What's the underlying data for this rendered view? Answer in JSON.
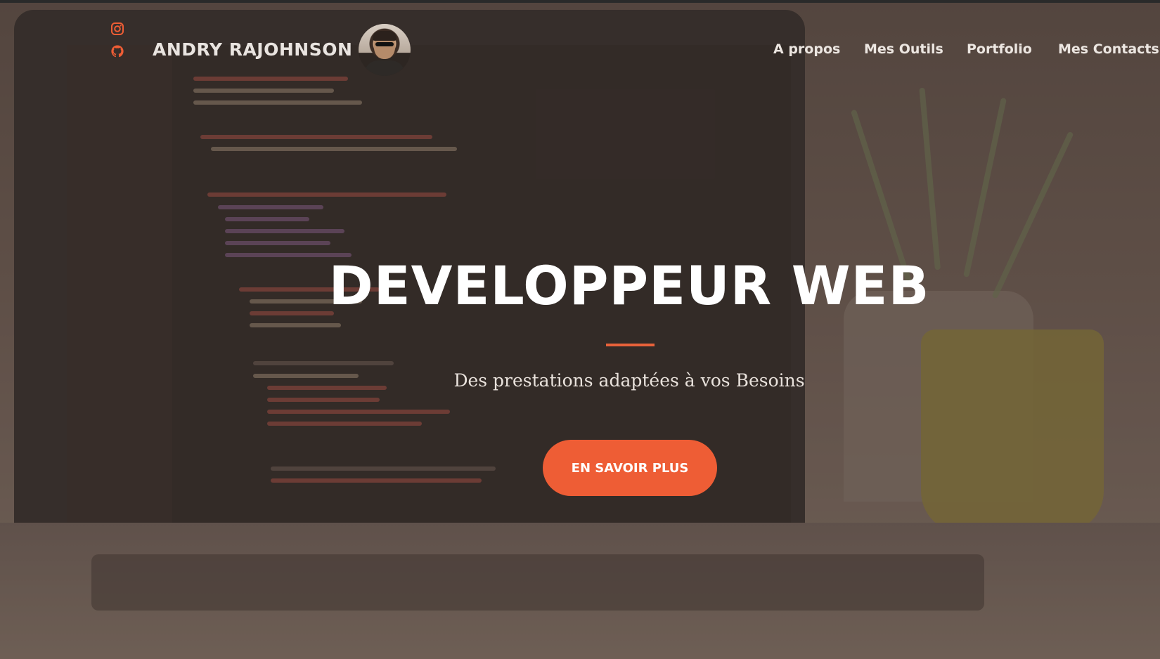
{
  "header": {
    "brand": "ANDRY RAJOHNSON",
    "social_icons": [
      "instagram-icon",
      "github-icon"
    ],
    "nav": [
      "A propos",
      "Mes Outils",
      "Portfolio",
      "Mes Contacts"
    ]
  },
  "hero": {
    "title": "DEVELOPPEUR WEB",
    "subtitle": "Des prestations adaptées à vos Besoins",
    "cta_label": "EN SAVOIR PLUS"
  },
  "colors": {
    "accent": "#ee5d35",
    "text": "#ffffff",
    "overlay": "#5c4e47"
  }
}
